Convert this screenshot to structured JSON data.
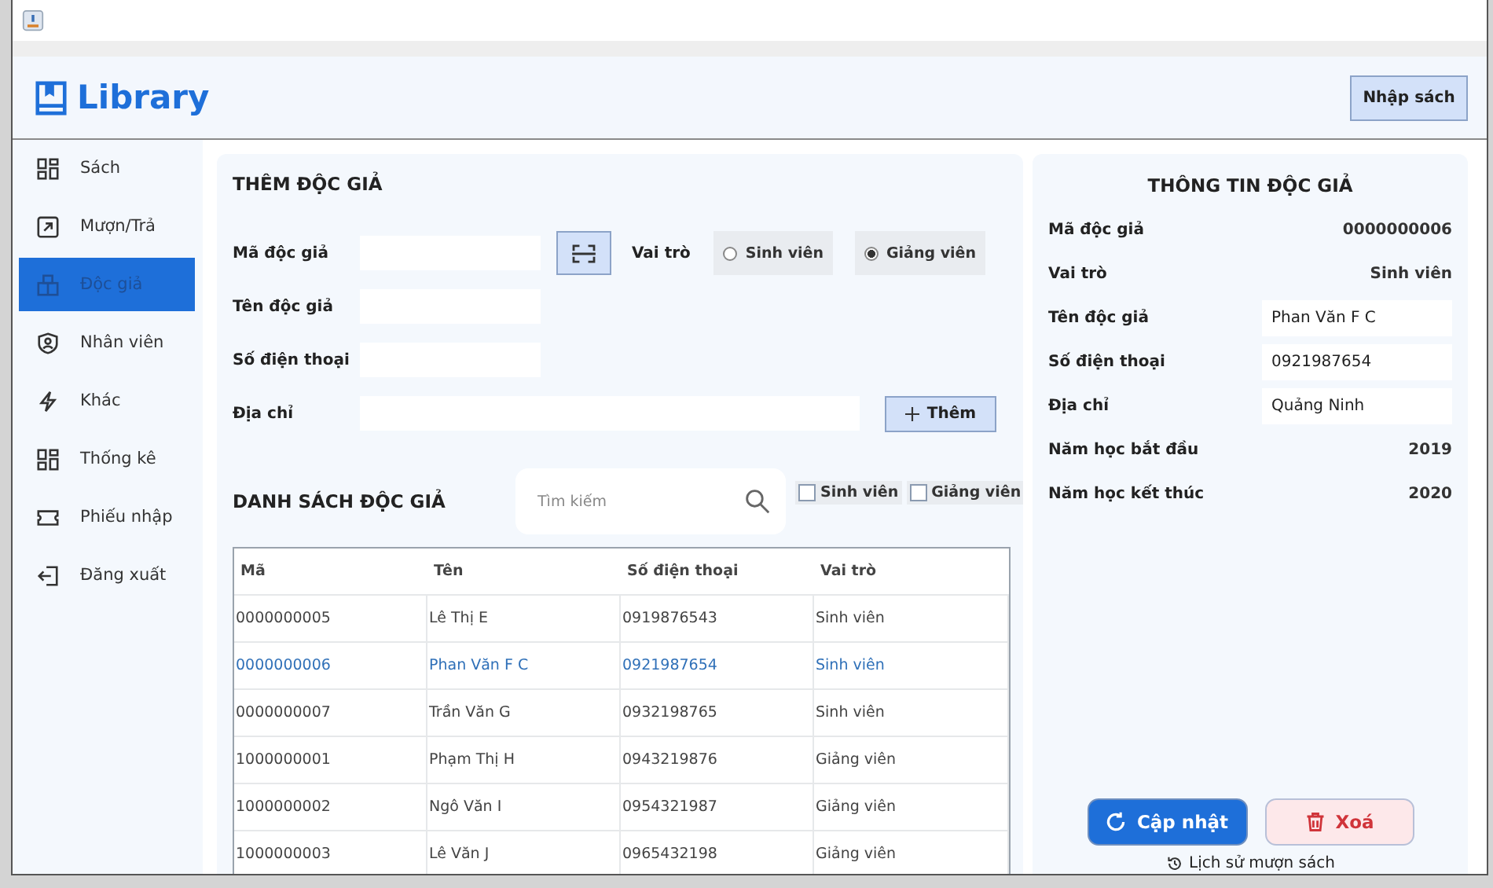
{
  "header": {
    "logo": "Library",
    "button": "Nhập sách"
  },
  "sidebar": {
    "items": [
      {
        "label": "Sách",
        "selected": false
      },
      {
        "label": "Mượn/Trả",
        "selected": false
      },
      {
        "label": "Độc giả",
        "selected": true
      },
      {
        "label": "Nhân viên",
        "selected": false
      },
      {
        "label": "Khác",
        "selected": false
      },
      {
        "label": "Thống kê",
        "selected": false
      },
      {
        "label": "Phiếu nhập",
        "selected": false
      },
      {
        "label": "Đăng xuất",
        "selected": false
      }
    ]
  },
  "add_form": {
    "title": "THÊM ĐỘC GIẢ",
    "fields": [
      {
        "label": "Mã độc giả"
      },
      {
        "label": "Tên độc giả"
      },
      {
        "label": "Số điện thoại"
      },
      {
        "label": "Địa chỉ"
      }
    ],
    "role_label": "Vai trò",
    "roles": [
      {
        "label": "Sinh viên",
        "selected": false
      },
      {
        "label": "Giảng viên",
        "selected": true
      }
    ],
    "add_button": "Thêm"
  },
  "list": {
    "title": "DANH SÁCH ĐỘC GIẢ",
    "search": {
      "placeholder": "Tìm kiếm"
    },
    "filters": [
      {
        "label": "Sinh viên",
        "checked": false
      },
      {
        "label": "Giảng viên",
        "checked": false
      }
    ],
    "table": {
      "columns": [
        "Mã",
        "Tên",
        "Số điện thoại",
        "Vai trò"
      ],
      "rows": [
        {
          "cells": [
            "0000000005",
            "Lê Thị E",
            "0919876543",
            "Sinh viên"
          ],
          "selected": false
        },
        {
          "cells": [
            "0000000006",
            "Phan Văn F C",
            "0921987654",
            "Sinh viên"
          ],
          "selected": true
        },
        {
          "cells": [
            "0000000007",
            "Trần Văn G",
            "0932198765",
            "Sinh viên"
          ],
          "selected": false
        },
        {
          "cells": [
            "1000000001",
            "Phạm Thị H",
            "0943219876",
            "Giảng viên"
          ],
          "selected": false
        },
        {
          "cells": [
            "1000000002",
            "Ngô Văn I",
            "0954321987",
            "Giảng viên"
          ],
          "selected": false
        },
        {
          "cells": [
            "1000000003",
            "Lê Văn J",
            "0965432198",
            "Giảng viên"
          ],
          "selected": false
        }
      ]
    }
  },
  "info": {
    "title": "THÔNG TIN ĐỘC GIẢ",
    "rows": [
      {
        "kind": "text",
        "label": "Mã độc giả",
        "value": "0000000006"
      },
      {
        "kind": "text",
        "label": "Vai trò",
        "value": "Sinh viên"
      },
      {
        "kind": "field",
        "label": "Tên độc giả",
        "value": "Phan Văn F C"
      },
      {
        "kind": "field",
        "label": "Số điện thoại",
        "value": "0921987654"
      },
      {
        "kind": "field",
        "label": "Địa chỉ",
        "value": "Quảng Ninh"
      },
      {
        "kind": "text",
        "label": "Năm học bắt đầu",
        "value": "2019"
      },
      {
        "kind": "text",
        "label": "Năm học kết thúc",
        "value": "2020"
      }
    ],
    "update_button": "Cập nhật",
    "delete_button": "Xoá",
    "history_link": "Lịch sử mượn sách"
  }
}
